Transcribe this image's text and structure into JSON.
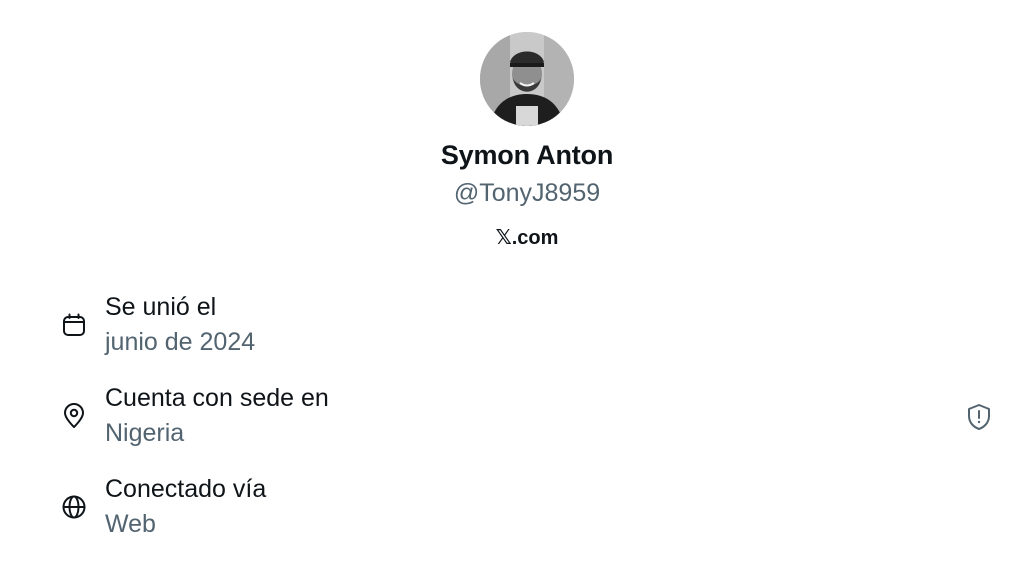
{
  "profile": {
    "display_name": "Symon Anton",
    "handle": "@TonyJ8959",
    "brand_suffix": ".com",
    "brand_glyph": "𝕏"
  },
  "about": {
    "items": [
      {
        "icon": "calendar-icon",
        "label": "Se unió el",
        "value": "junio de 2024"
      },
      {
        "icon": "location-pin-icon",
        "label": "Cuenta con sede en",
        "value": "Nigeria"
      },
      {
        "icon": "globe-icon",
        "label": "Conectado vía",
        "value": "Web"
      }
    ]
  },
  "colors": {
    "primary_text": "#0f1419",
    "secondary_text": "#536471",
    "background": "#ffffff"
  }
}
